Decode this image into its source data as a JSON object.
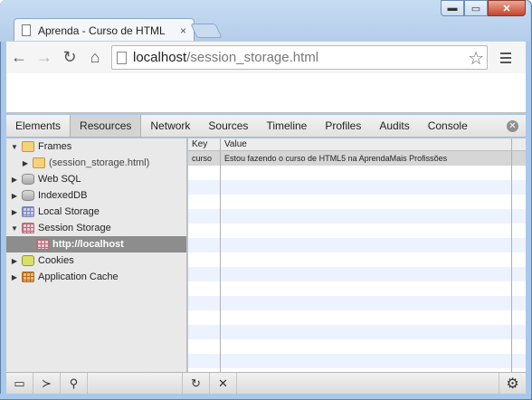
{
  "window": {
    "tab_title": "Aprenda - Curso de HTML",
    "tab_close": "×",
    "minimize": "▬",
    "maximize": "▭",
    "close": "✕"
  },
  "toolbar": {
    "back": "←",
    "forward": "→",
    "reload": "↻",
    "home": "⌂",
    "url_host": "localhost",
    "url_path": "/session_storage.html",
    "star": "☆"
  },
  "devtools": {
    "tabs": [
      "Elements",
      "Resources",
      "Network",
      "Sources",
      "Timeline",
      "Profiles",
      "Audits",
      "Console"
    ],
    "active_tab": "Resources",
    "close": "✕"
  },
  "sidebar": {
    "items": [
      {
        "label": "Frames",
        "arrow": "▼",
        "icon": "folder-icon"
      },
      {
        "label": "(session_storage.html)",
        "arrow": "▶",
        "icon": "folder-icon"
      },
      {
        "label": "Web SQL",
        "arrow": "▶",
        "icon": "db-icon"
      },
      {
        "label": "IndexedDB",
        "arrow": "▶",
        "icon": "db-icon"
      },
      {
        "label": "Local Storage",
        "arrow": "▶",
        "icon": "storage-icon"
      },
      {
        "label": "Session Storage",
        "arrow": "▼",
        "icon": "session-storage-icon"
      },
      {
        "label": "http://localhost",
        "arrow": "",
        "icon": "session-storage-icon"
      },
      {
        "label": "Cookies",
        "arrow": "▶",
        "icon": "cookie-icon"
      },
      {
        "label": "Application Cache",
        "arrow": "▶",
        "icon": "app-cache-icon"
      }
    ]
  },
  "grid": {
    "headers": {
      "key": "Key",
      "value": "Value"
    },
    "rows": [
      {
        "key": "curso",
        "value": "Estou fazendo o curso de HTML5 na AprendaMais Profissões"
      }
    ]
  },
  "statusbar": {
    "dock": "▭",
    "console": "≻",
    "search": "⚲",
    "refresh": "↻",
    "delete": "✕",
    "settings": "⚙"
  }
}
